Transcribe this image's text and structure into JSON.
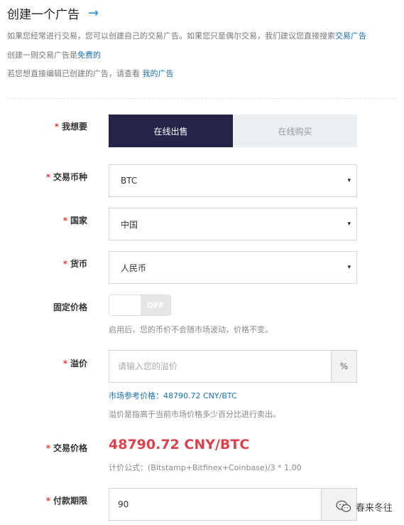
{
  "header": {
    "title": "创建一个广告",
    "arrow": "→"
  },
  "intro": {
    "line1_prefix": "如果您经常进行交易，您可以创建自己的交易广告。如果您只是偶尔交易，我们建议您直接搜索",
    "line1_link": "交易广告",
    "line2_prefix": "创建一则交易广告是",
    "line2_link": "免费的",
    "line3_prefix": "若您想直接编辑已创建的广告，请查看",
    "line3_link": "我的广告"
  },
  "form": {
    "required_mark": "*",
    "want": {
      "label": "我想要",
      "options": [
        "在线出售",
        "在线购买"
      ],
      "selected": "在线出售"
    },
    "coin": {
      "label": "交易币种",
      "value": "BTC"
    },
    "country": {
      "label": "国家",
      "value": "中国"
    },
    "currency": {
      "label": "货币",
      "value": "人民币"
    },
    "fixed_price": {
      "label": "固定价格",
      "state": "OFF",
      "hint": "启用后，您的币价不会随市场波动，价格不变。"
    },
    "premium": {
      "label": "溢价",
      "placeholder": "请输入您的溢价",
      "unit": "%",
      "market_ref": "市场参考价格：48790.72 CNY/BTC",
      "hint": "溢价是指高于当前市场价格多少百分比进行卖出。"
    },
    "trade_price": {
      "label": "交易价格",
      "value": "48790.72 CNY/BTC",
      "formula": "计价公式：(Bitstamp+Bitfinex+Coinbase)/3 * 1.00"
    },
    "payment_window": {
      "label": "付款期限",
      "value": "90"
    }
  },
  "watermark": {
    "text": "春来冬往",
    "icon": "wechat-icon"
  },
  "colors": {
    "accent_dark": "#232448",
    "link_blue": "#1a6fb8",
    "price_red": "#d9434e",
    "required_red": "#e0403b"
  },
  "icons": {
    "select_caret": "▾"
  }
}
